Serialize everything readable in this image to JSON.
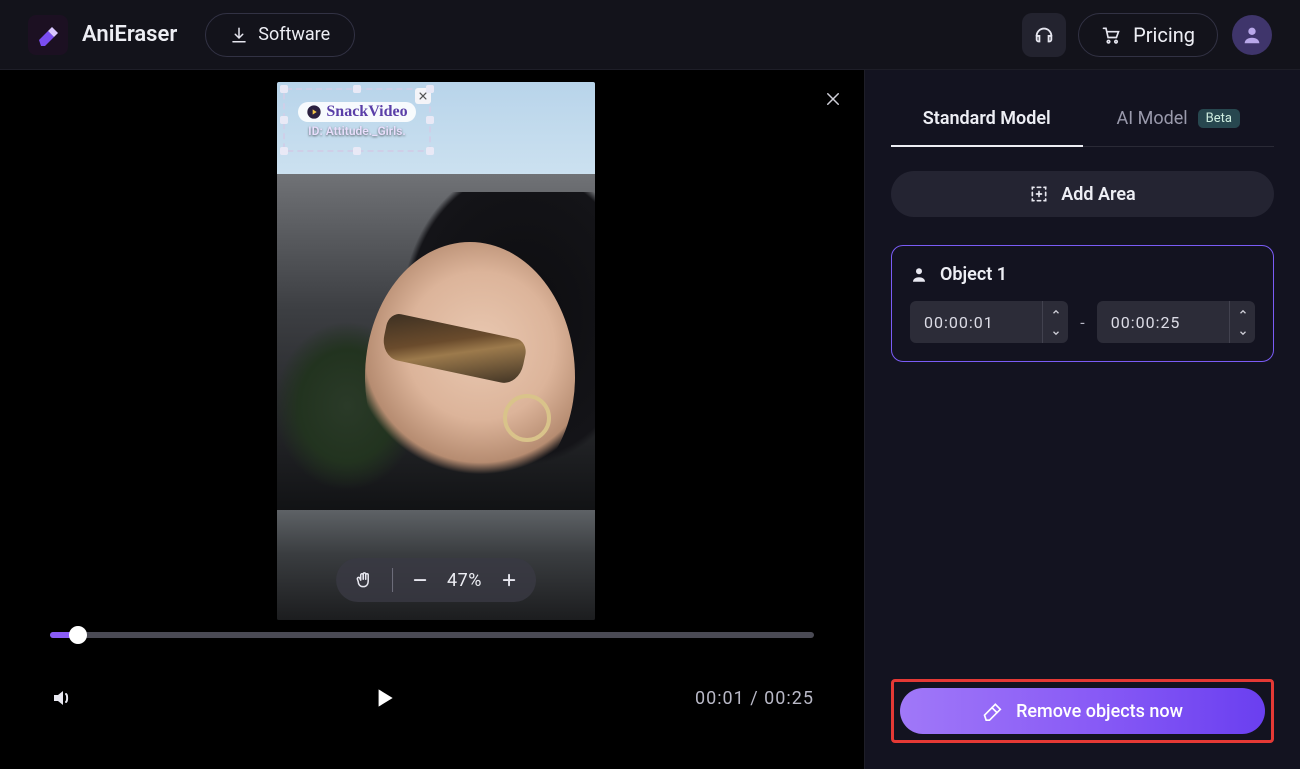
{
  "header": {
    "brand": "AniEraser",
    "software_label": "Software",
    "pricing_label": "Pricing"
  },
  "preview": {
    "watermark_brand": "SnackVideo",
    "watermark_id_line": "ID: Attitude._Girls.",
    "zoom_value": "47%"
  },
  "player": {
    "current_time": "00:01",
    "total_time": "00:25",
    "time_display": "00:01 / 00:25",
    "progress_percent": 3.6
  },
  "sidebar": {
    "tabs": {
      "standard": "Standard Model",
      "ai": "AI Model",
      "ai_badge": "Beta",
      "active": "standard"
    },
    "add_area_label": "Add Area",
    "object": {
      "title": "Object 1",
      "start": "00:00:01",
      "end": "00:00:25",
      "separator": "-"
    },
    "remove_label": "Remove objects now"
  },
  "colors": {
    "accent": "#8a5cf6",
    "highlight": "#e53935"
  }
}
